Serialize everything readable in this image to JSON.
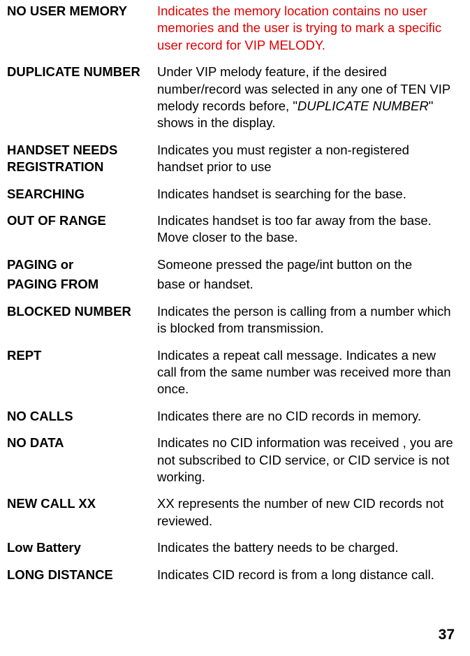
{
  "entries": [
    {
      "term": "NO USER MEMORY",
      "definition": "Indicates the memory location contains no user memories and the user is trying to mark a specific user record for VIP MELODY.",
      "red": true
    },
    {
      "term": "DUPLICATE NUMBER",
      "definition_pre": "Under VIP melody feature, if the desired number/record was selected in any one of TEN VIP melody records before, \"",
      "definition_italic": "DUPLICATE NUMBER",
      "definition_post": "\" shows in the display."
    },
    {
      "term": "HANDSET NEEDS REGISTRATION",
      "definition": "Indicates you must register a non-registered handset prior to use"
    },
    {
      "term": "SEARCHING",
      "definition": "Indicates handset is searching for the base."
    },
    {
      "term": "OUT OF RANGE",
      "definition": "Indicates handset is too far away from the base. Move closer to the base."
    },
    {
      "term": "PAGING or",
      "definition": "Someone pressed the page/int button on the",
      "tight": true
    },
    {
      "term": "PAGING FROM",
      "definition": "base or handset."
    },
    {
      "term": "BLOCKED NUMBER",
      "definition": "Indicates the person is calling from a number which is blocked from transmission."
    },
    {
      "term": "REPT",
      "definition": "Indicates a repeat call message. Indicates a new call  from the same number was received more than once."
    },
    {
      "term": "NO CALLS",
      "definition": "Indicates there are no CID records in memory."
    },
    {
      "term": "NO DATA",
      "definition": "Indicates no CID information was received , you are not subscribed to CID service, or CID service is not working."
    },
    {
      "term": "NEW CALL XX",
      "definition": "XX represents the number of new CID records not reviewed."
    },
    {
      "term": "Low Battery",
      "definition": "Indicates the battery needs to be charged."
    },
    {
      "term": "LONG DISTANCE",
      "definition": "Indicates CID record is from a long distance call."
    }
  ],
  "page_number": "37"
}
